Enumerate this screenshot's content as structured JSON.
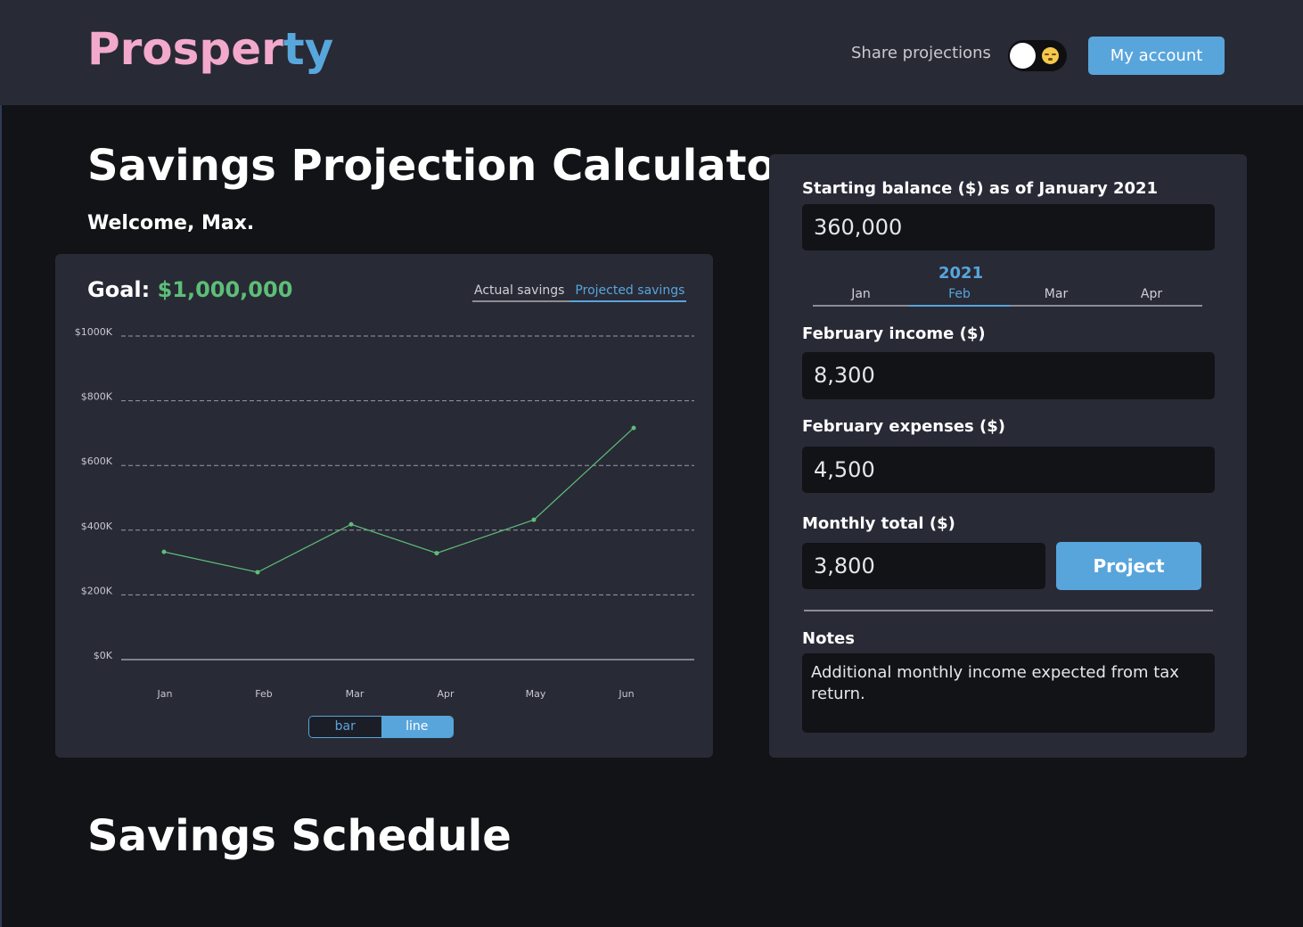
{
  "header": {
    "logo_part1": "Prosper",
    "logo_part2": "ty",
    "share_label": "Share projections",
    "account_label": "My account"
  },
  "page_title": "Savings Projection Calculator",
  "welcome": "Welcome, Max.",
  "chart_card": {
    "goal_label": "Goal: ",
    "goal_value": "$1,000,000",
    "legend_actual": "Actual savings",
    "legend_projected": "Projected savings",
    "toggle_bar": "bar",
    "toggle_line": "line"
  },
  "chart_data": {
    "type": "line",
    "categories": [
      "Jan",
      "Feb",
      "Mar",
      "Apr",
      "May",
      "Jun"
    ],
    "series": [
      {
        "values": [
          333,
          270,
          418,
          329,
          432,
          716
        ]
      }
    ],
    "y_ticks": [
      "$1000K",
      "$800K",
      "$600K",
      "$400K",
      "$200K",
      "$0K"
    ],
    "y_tick_values": [
      1000,
      800,
      600,
      400,
      200,
      0
    ],
    "ylim": [
      0,
      1000
    ],
    "grid": true,
    "line_color": "#5dbe77"
  },
  "form": {
    "starting_label": "Starting balance ($) as of January 2021",
    "starting_value": "360,000",
    "year": "2021",
    "months": [
      "Jan",
      "Feb",
      "Mar",
      "Apr"
    ],
    "selected_month": "Feb",
    "income_label": "February income ($)",
    "income_value": "8,300",
    "expenses_label": "February expenses ($)",
    "expenses_value": "4,500",
    "total_label": "Monthly total ($)",
    "total_value": "3,800",
    "project_label": "Project",
    "notes_label": "Notes",
    "notes_value": "Additional monthly income expected from tax return."
  },
  "schedule_title": "Savings Schedule",
  "colors": {
    "accent_blue": "#58a5dc",
    "logo_pink": "#f3a9cb",
    "goal_green": "#5dbe77"
  }
}
